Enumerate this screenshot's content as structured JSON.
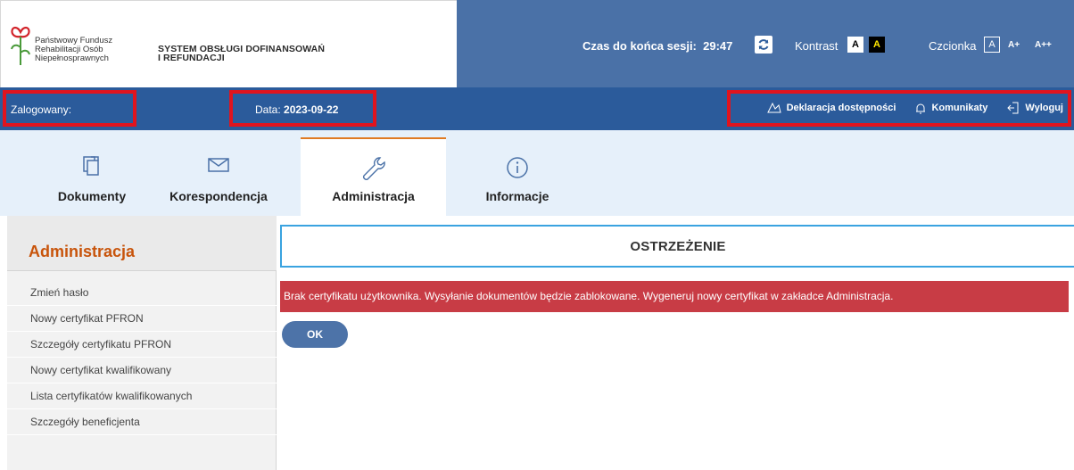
{
  "header": {
    "org_lines": [
      "Państwowy Fundusz",
      "Rehabilitacji Osób",
      "Niepełnosprawnych"
    ],
    "system_lines": [
      "SYSTEM OBSŁUGI DOFINANSOWAŃ",
      "I REFUNDACJI"
    ],
    "session_label": "Czas do końca sesji:",
    "session_time": "29:47",
    "contrast_label": "Kontrast",
    "contrast_normal": "A",
    "contrast_high": "A",
    "font_label": "Czcionka",
    "font_normal": "A",
    "font_larger": "A+",
    "font_largest": "A++"
  },
  "infobar": {
    "logged_label": "Zalogowany:",
    "date_label": "Data:",
    "date_value": "2023-09-22",
    "links": [
      "Deklaracja dostępności",
      "Komunikaty",
      "Wyloguj"
    ]
  },
  "tabs": [
    {
      "label": "Dokumenty",
      "icon": "documents-icon"
    },
    {
      "label": "Korespondencja",
      "icon": "envelope-icon"
    },
    {
      "label": "Administracja",
      "icon": "wrench-icon",
      "active": true
    },
    {
      "label": "Informacje",
      "icon": "info-icon"
    }
  ],
  "sidebar": {
    "title": "Administracja",
    "items": [
      "Zmień hasło",
      "Nowy certyfikat PFRON",
      "Szczegóły certyfikatu PFRON",
      "Nowy certyfikat kwalifikowany",
      "Lista certyfikatów kwalifikowanych",
      "Szczegóły beneficjenta"
    ]
  },
  "main": {
    "warning_title": "OSTRZEŻENIE",
    "alert_text": "Brak certyfikatu użytkownika. Wysyłanie dokumentów będzie zablokowane. Wygeneruj nowy certyfikat w zakładce Administracja.",
    "ok_label": "OK"
  },
  "colors": {
    "header_blue": "#4a71a7",
    "infobar_blue": "#2b5b9b",
    "tabbar_bg": "#e6f0fa",
    "accent_orange": "#c8540b",
    "alert_red": "#c83c45",
    "highlight_red": "#e0141e"
  }
}
